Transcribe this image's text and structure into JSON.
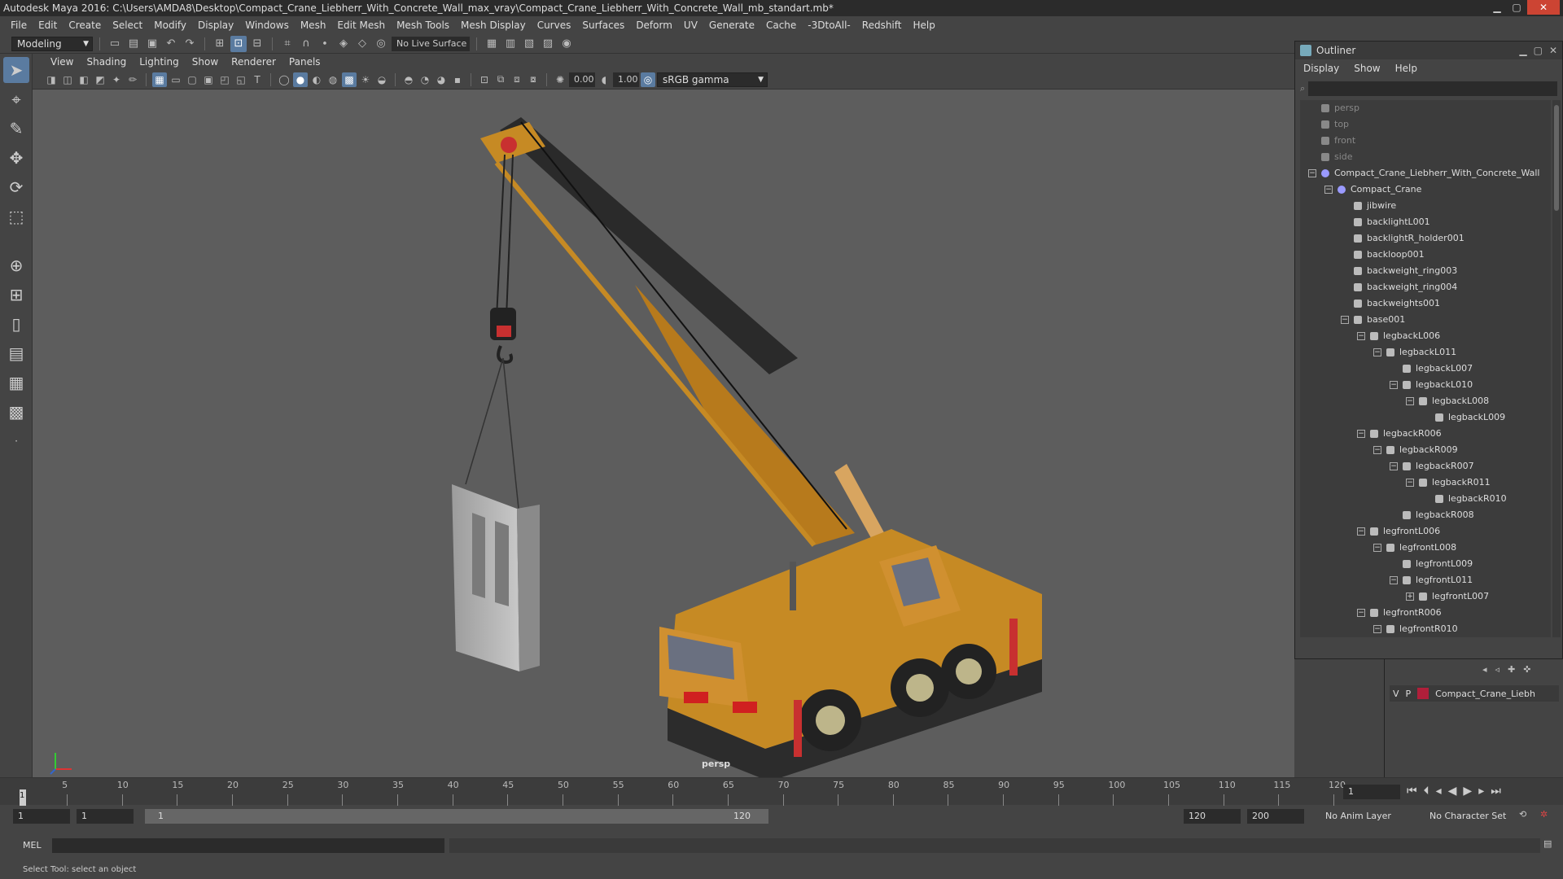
{
  "window": {
    "title": "Autodesk Maya 2016: C:\\Users\\AMDA8\\Desktop\\Compact_Crane_Liebherr_With_Concrete_Wall_max_vray\\Compact_Crane_Liebherr_With_Concrete_Wall_mb_standart.mb*"
  },
  "menubar": [
    "File",
    "Edit",
    "Create",
    "Select",
    "Modify",
    "Display",
    "Windows",
    "Mesh",
    "Edit Mesh",
    "Mesh Tools",
    "Mesh Display",
    "Curves",
    "Surfaces",
    "Deform",
    "UV",
    "Generate",
    "Cache",
    "-3DtoAll-",
    "Redshift",
    "Help"
  ],
  "shelf": {
    "mode": "Modeling",
    "live_surface": "No Live Surface"
  },
  "viewport": {
    "menu": [
      "View",
      "Shading",
      "Lighting",
      "Show",
      "Renderer",
      "Panels"
    ],
    "exposure": "0.00",
    "gamma": "1.00",
    "color_space": "sRGB gamma",
    "camera_label": "persp"
  },
  "outliner": {
    "title": "Outliner",
    "menu": [
      "Display",
      "Show",
      "Help"
    ],
    "rows": [
      {
        "label": "persp",
        "indent": 0,
        "kind": "camera",
        "dim": true
      },
      {
        "label": "top",
        "indent": 0,
        "kind": "camera",
        "dim": true
      },
      {
        "label": "front",
        "indent": 0,
        "kind": "camera",
        "dim": true
      },
      {
        "label": "side",
        "indent": 0,
        "kind": "camera",
        "dim": true
      },
      {
        "label": "Compact_Crane_Liebherr_With_Concrete_Wall",
        "indent": 0,
        "kind": "group",
        "expander": "−"
      },
      {
        "label": "Compact_Crane",
        "indent": 1,
        "kind": "group",
        "expander": "−"
      },
      {
        "label": "jibwire",
        "indent": 2,
        "kind": "mesh"
      },
      {
        "label": "backlightL001",
        "indent": 2,
        "kind": "mesh"
      },
      {
        "label": "backlightR_holder001",
        "indent": 2,
        "kind": "mesh"
      },
      {
        "label": "backloop001",
        "indent": 2,
        "kind": "mesh"
      },
      {
        "label": "backweight_ring003",
        "indent": 2,
        "kind": "mesh"
      },
      {
        "label": "backweight_ring004",
        "indent": 2,
        "kind": "mesh"
      },
      {
        "label": "backweights001",
        "indent": 2,
        "kind": "mesh"
      },
      {
        "label": "base001",
        "indent": 2,
        "kind": "mesh",
        "expander": "−"
      },
      {
        "label": "legbackL006",
        "indent": 3,
        "kind": "mesh",
        "expander": "−"
      },
      {
        "label": "legbackL011",
        "indent": 4,
        "kind": "mesh",
        "expander": "−"
      },
      {
        "label": "legbackL007",
        "indent": 5,
        "kind": "mesh"
      },
      {
        "label": "legbackL010",
        "indent": 5,
        "kind": "mesh",
        "expander": "−"
      },
      {
        "label": "legbackL008",
        "indent": 6,
        "kind": "mesh",
        "expander": "−"
      },
      {
        "label": "legbackL009",
        "indent": 7,
        "kind": "mesh"
      },
      {
        "label": "legbackR006",
        "indent": 3,
        "kind": "mesh",
        "expander": "−"
      },
      {
        "label": "legbackR009",
        "indent": 4,
        "kind": "mesh",
        "expander": "−"
      },
      {
        "label": "legbackR007",
        "indent": 5,
        "kind": "mesh",
        "expander": "−"
      },
      {
        "label": "legbackR011",
        "indent": 6,
        "kind": "mesh",
        "expander": "−"
      },
      {
        "label": "legbackR010",
        "indent": 7,
        "kind": "mesh"
      },
      {
        "label": "legbackR008",
        "indent": 5,
        "kind": "mesh"
      },
      {
        "label": "legfrontL006",
        "indent": 3,
        "kind": "mesh",
        "expander": "−"
      },
      {
        "label": "legfrontL008",
        "indent": 4,
        "kind": "mesh",
        "expander": "−"
      },
      {
        "label": "legfrontL009",
        "indent": 5,
        "kind": "mesh"
      },
      {
        "label": "legfrontL011",
        "indent": 5,
        "kind": "mesh",
        "expander": "−"
      },
      {
        "label": "legfrontL007",
        "indent": 6,
        "kind": "mesh",
        "expander": "+"
      },
      {
        "label": "legfrontR006",
        "indent": 3,
        "kind": "mesh",
        "expander": "−"
      },
      {
        "label": "legfrontR010",
        "indent": 4,
        "kind": "mesh",
        "expander": "−"
      }
    ]
  },
  "layers": {
    "visible": "V",
    "playback": "P",
    "layer_name": "Compact_Crane_Liebh",
    "layer_color": "#b01f3a"
  },
  "timeline": {
    "ticks": [
      "5",
      "10",
      "15",
      "20",
      "25",
      "30",
      "35",
      "40",
      "45",
      "50",
      "55",
      "60",
      "65",
      "70",
      "75",
      "80",
      "85",
      "90",
      "95",
      "100",
      "105",
      "110",
      "115",
      "120"
    ],
    "playhead_label": "1",
    "current_frame": "1"
  },
  "range": {
    "start": "1",
    "start2": "1",
    "slider_start": "1",
    "slider_end": "120",
    "end": "120",
    "anim_end": "200",
    "anim_layer": "No Anim Layer",
    "character_set": "No Character Set"
  },
  "mel": {
    "label": "MEL"
  },
  "status": {
    "text": "Select Tool: select an object"
  }
}
